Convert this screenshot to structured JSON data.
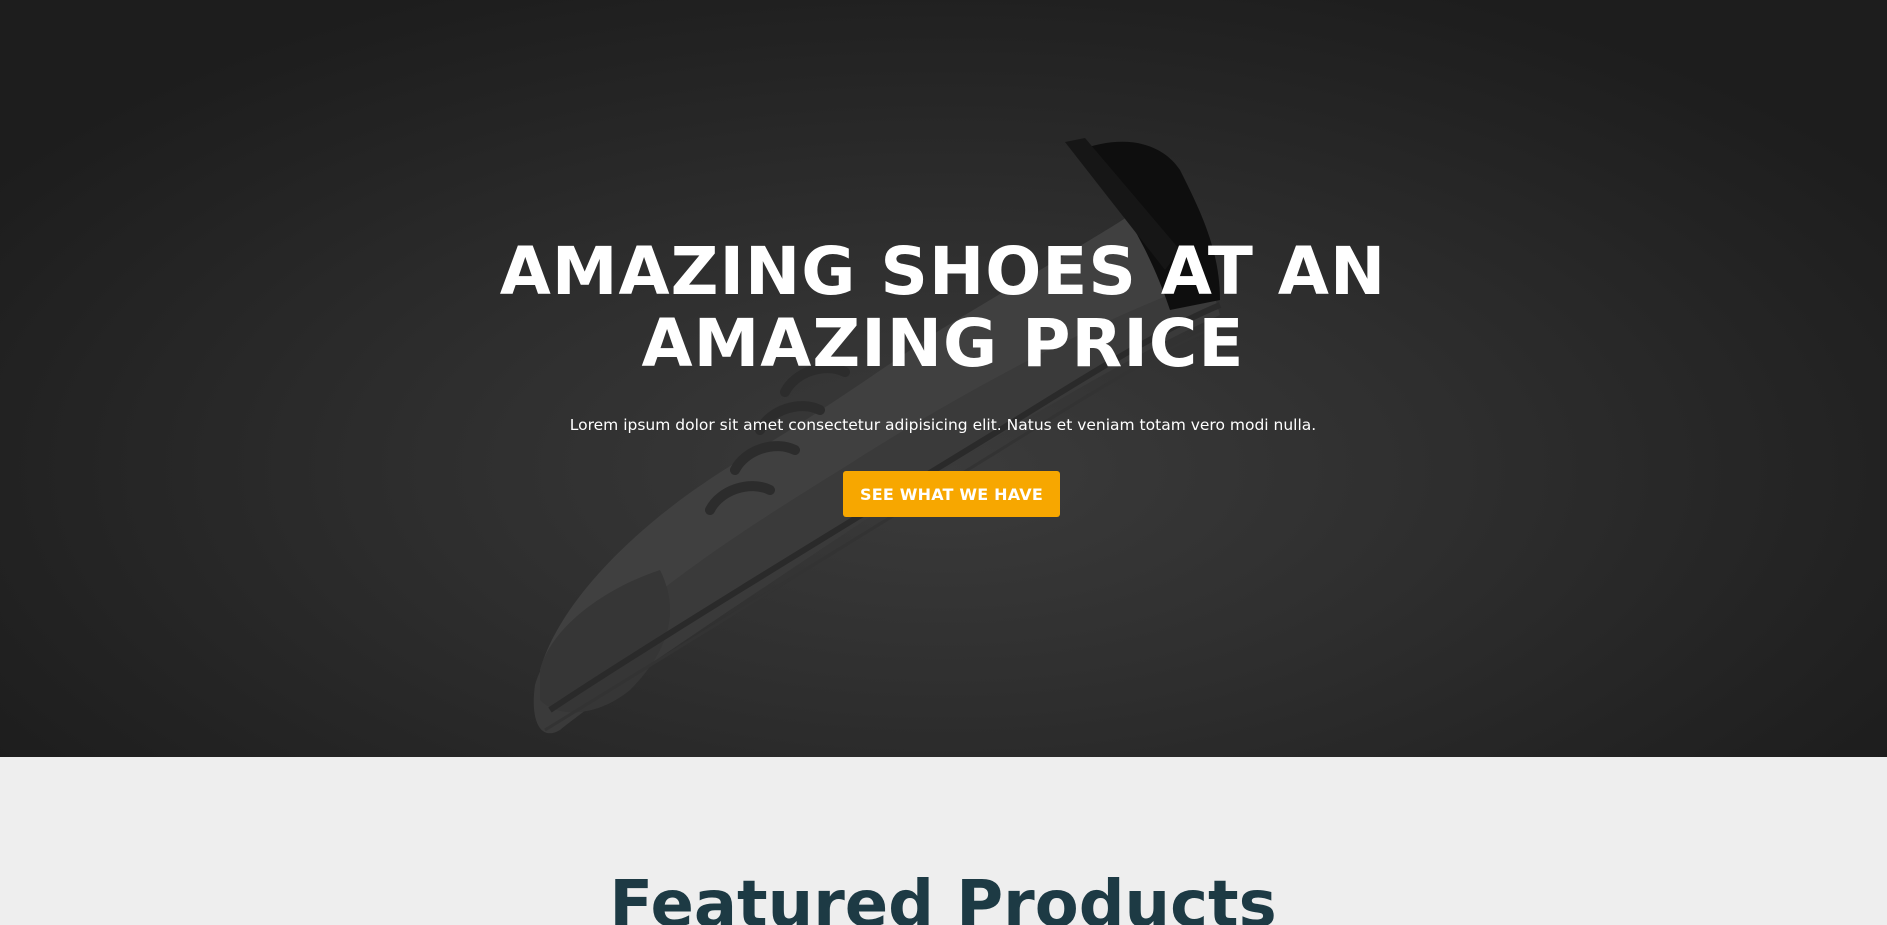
{
  "hero": {
    "title": "AMAZING SHOES AT AN AMAZING PRICE",
    "subtitle": "Lorem ipsum dolor sit amet consectetur adipisicing elit. Natus et veniam totam vero modi nulla.",
    "cta_label": "SEE WHAT WE HAVE",
    "background_image": "sneaker-photo",
    "accent_color": "#f7a700"
  },
  "featured": {
    "title": "Featured Products",
    "title_color": "#1d3a44"
  }
}
